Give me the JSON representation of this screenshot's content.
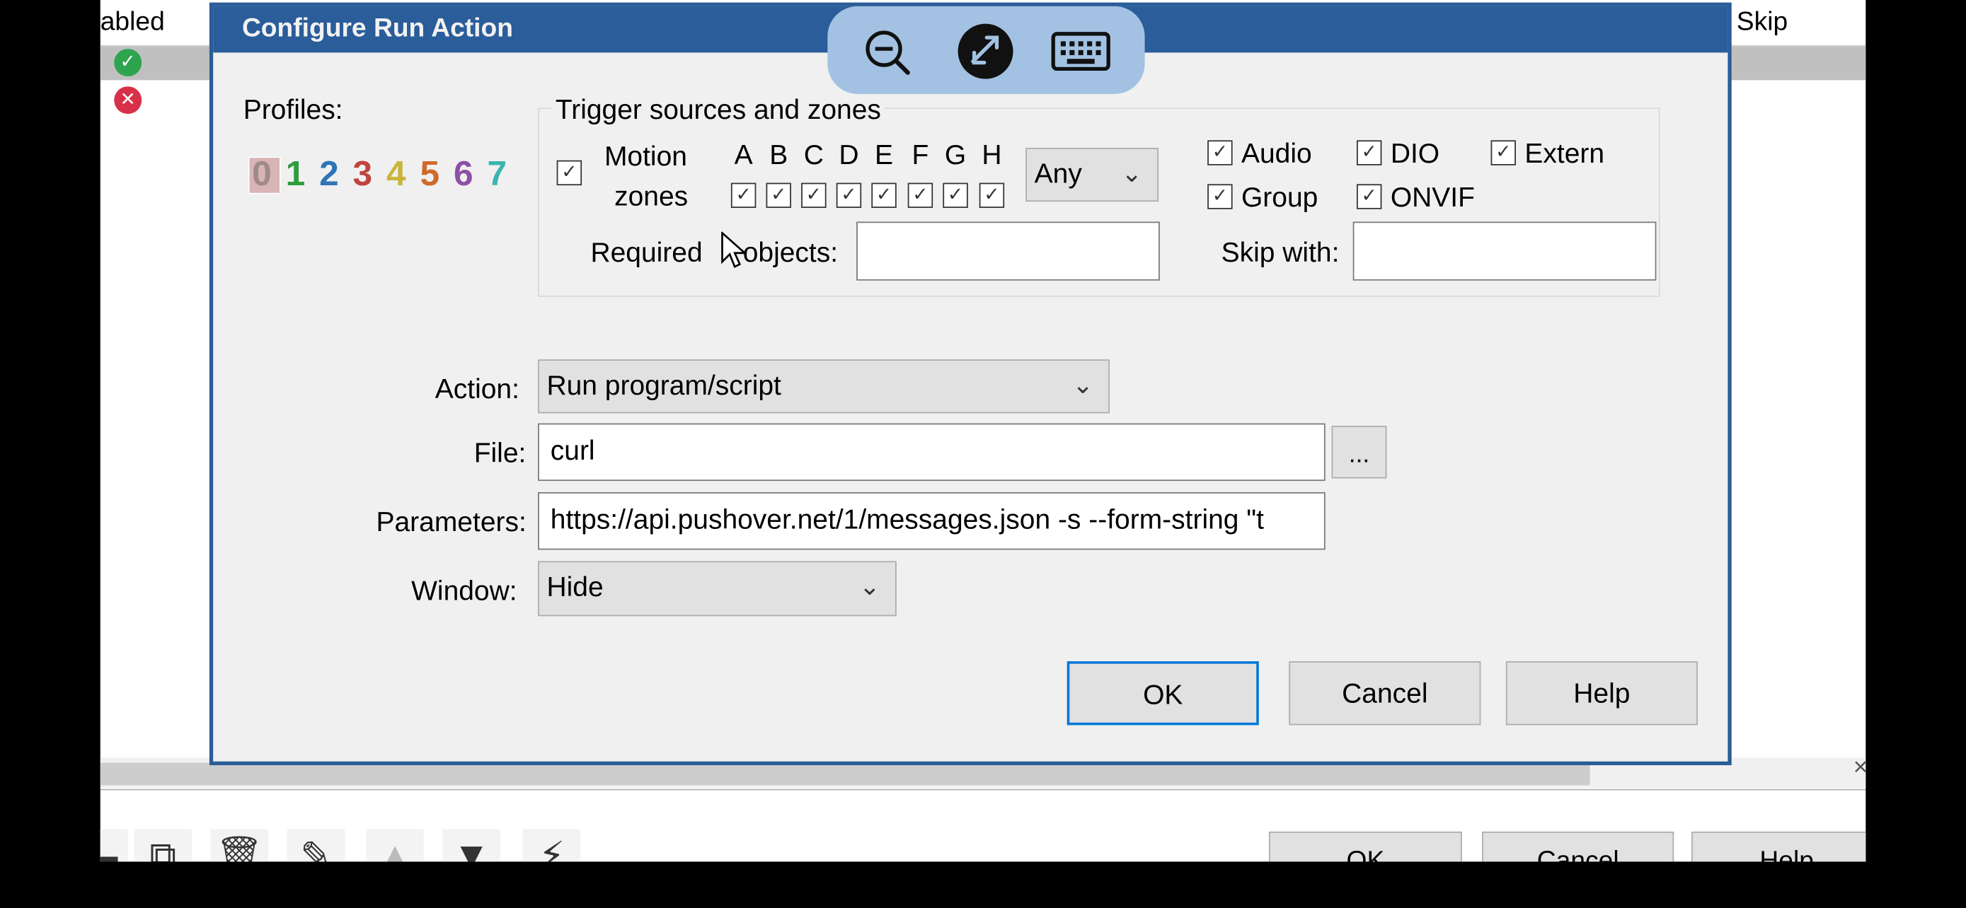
{
  "background_window": {
    "col_enabled": "abled",
    "col_skip": "Skip",
    "row_status": [
      "enabled",
      "disabled"
    ],
    "buttons": {
      "ok": "OK",
      "cancel": "Cancel",
      "help": "Help"
    },
    "close_glyph": "×"
  },
  "remote_toolbar": {
    "zoom_out_icon": "zoom-out-icon",
    "disconnect_icon": "remote-disconnect-icon",
    "keyboard_icon": "keyboard-icon"
  },
  "dialog": {
    "title": "Configure Run Action",
    "profiles_label": "Profiles:",
    "profiles": [
      {
        "label": "0",
        "color": "#9e8a8a",
        "selected": true
      },
      {
        "label": "1",
        "color": "#2e9e3e"
      },
      {
        "label": "2",
        "color": "#2f73b8"
      },
      {
        "label": "3",
        "color": "#c0443e"
      },
      {
        "label": "4",
        "color": "#c9b53a"
      },
      {
        "label": "5",
        "color": "#d06a2a"
      },
      {
        "label": "6",
        "color": "#8e4fa5"
      },
      {
        "label": "7",
        "color": "#3ab5b0"
      }
    ],
    "trigger": {
      "group_title": "Trigger sources and zones",
      "motion_label_1": "Motion",
      "motion_label_2": "zones",
      "motion_checked": true,
      "zones": [
        "A",
        "B",
        "C",
        "D",
        "E",
        "F",
        "G",
        "H"
      ],
      "zones_checked": [
        true,
        true,
        true,
        true,
        true,
        true,
        true,
        true
      ],
      "zone_mode": "Any",
      "sources": {
        "audio": "Audio",
        "dio": "DIO",
        "extern": "Extern",
        "group": "Group",
        "onvif": "ONVIF"
      },
      "sources_checked": {
        "audio": true,
        "dio": true,
        "extern": true,
        "group": true,
        "onvif": true
      },
      "required_objects_label": "Required AI objects:",
      "required_objects_prefix": "Required ",
      "required_objects_suffix": " objects:",
      "required_objects_value": "",
      "skip_with_label": "Skip with:",
      "skip_with_value": ""
    },
    "action_label": "Action:",
    "action_value": "Run program/script",
    "file_label": "File:",
    "file_value": "curl",
    "browse_label": "...",
    "parameters_label": "Parameters:",
    "parameters_value": "https://api.pushover.net/1/messages.json -s --form-string \"t",
    "window_label": "Window:",
    "window_value": "Hide",
    "buttons": {
      "ok": "OK",
      "cancel": "Cancel",
      "help": "Help"
    }
  }
}
